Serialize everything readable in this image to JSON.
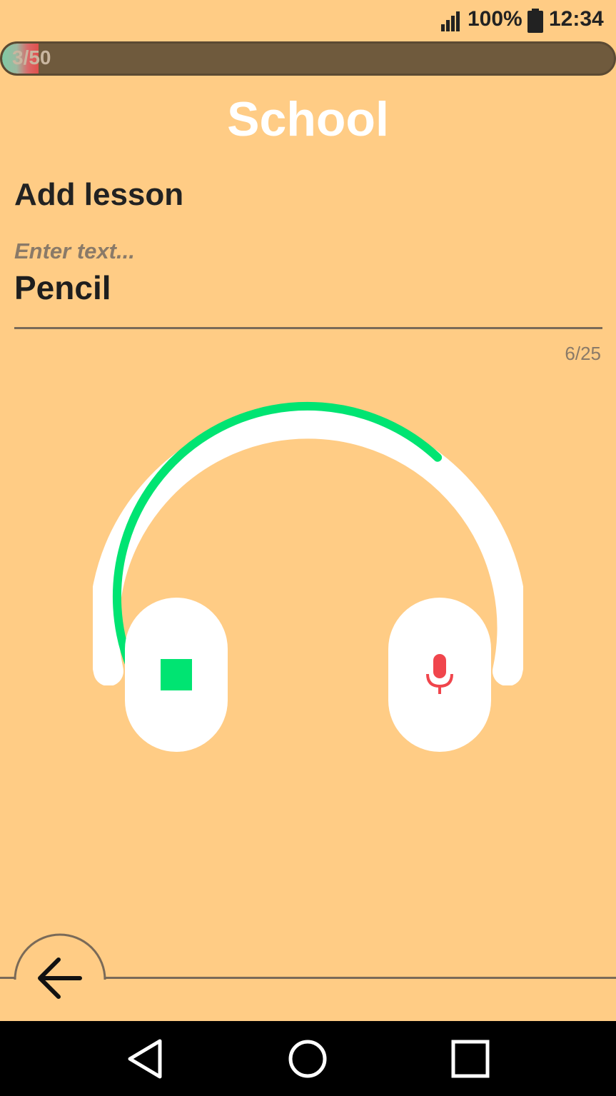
{
  "status_bar": {
    "battery_pct": "100%",
    "time": "12:34",
    "icons": [
      "signal-icon",
      "battery-icon"
    ]
  },
  "progress": {
    "label": "3/50",
    "current": 3,
    "total": 50
  },
  "title": "School",
  "lesson": {
    "heading": "Add lesson",
    "hint": "Enter text...",
    "value": "Pencil",
    "counter": "6/25"
  },
  "recorder": {
    "icons": [
      "headphones-icon",
      "stop-icon",
      "microphone-icon"
    ],
    "level": 0.62
  },
  "colors": {
    "background": "#FFCC85",
    "accent_green": "#00E472",
    "mic_red": "#F0454C",
    "white": "#FFFFFF"
  },
  "navigation": {
    "icons": [
      "back-arrow-icon",
      "nav-back-icon",
      "nav-home-icon",
      "nav-recents-icon"
    ]
  }
}
